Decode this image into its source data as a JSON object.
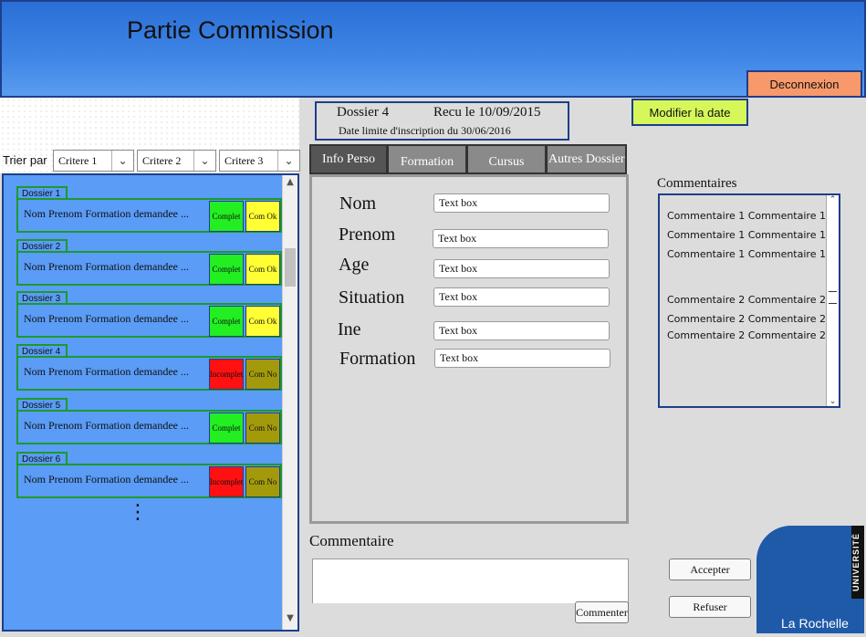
{
  "header": {
    "title": "Partie Commission",
    "logout_label": "Deconnexion"
  },
  "sort": {
    "label": "Trier par",
    "criteria": [
      "Critere 1",
      "Critere 2",
      "Critere 3"
    ]
  },
  "dossiers": [
    {
      "tag": "Dossier 1",
      "info": "Nom   Prenom   Formation demandee   ...",
      "status": "Complet",
      "status_color": "#22ee22",
      "com": "Com Ok",
      "com_color": "#ffff33"
    },
    {
      "tag": "Dossier 2",
      "info": "Nom   Prenom   Formation demandee   ...",
      "status": "Complet",
      "status_color": "#22ee22",
      "com": "Com Ok",
      "com_color": "#ffff33"
    },
    {
      "tag": "Dossier 3",
      "info": "Nom   Prenom   Formation demandee   ...",
      "status": "Complet",
      "status_color": "#22ee22",
      "com": "Com Ok",
      "com_color": "#ffff33"
    },
    {
      "tag": "Dossier 4",
      "info": "Nom   Prenom   Formation demandee   ...",
      "status": "Incomplet",
      "status_color": "#ff1111",
      "com": "Com No",
      "com_color": "#a39a0b"
    },
    {
      "tag": "Dossier 5",
      "info": "Nom   Prenom   Formation demandee   ...",
      "status": "Complet",
      "status_color": "#22ee22",
      "com": "Com No",
      "com_color": "#a39a0b"
    },
    {
      "tag": "Dossier 6",
      "info": "Nom   Prenom   Formation demandee   ...",
      "status": "Incomplet",
      "status_color": "#ff1111",
      "com": "Com No",
      "com_color": "#a39a0b"
    }
  ],
  "dossier_info": {
    "name": "Dossier 4",
    "received": "Recu le 10/09/2015",
    "deadline": "Date limite d'inscription du  30/06/2016",
    "modify_label": "Modifier la date"
  },
  "tabs": [
    "Info Perso",
    "Formation",
    "Cursus",
    "Autres Dossiers"
  ],
  "form": {
    "fields": [
      {
        "label": "Nom",
        "value": "Text box"
      },
      {
        "label": "Prenom",
        "value": "Text box"
      },
      {
        "label": "Age",
        "value": "Text box"
      },
      {
        "label": "Situation",
        "value": "Text box"
      },
      {
        "label": "Ine",
        "value": "Text box"
      },
      {
        "label": "Formation",
        "value": "Text box"
      }
    ]
  },
  "comment": {
    "label": "Commentaire",
    "submit_label": "Commenter"
  },
  "comments": {
    "title": "Commentaires",
    "lines": [
      "Commentaire 1 Commentaire 1",
      "Commentaire 1 Commentaire 1",
      "Commentaire 1 Commentaire 1",
      "Commentaire 2 Commentaire 2",
      "Commentaire 2 Commentaire 2",
      "Commentaire 2 Commentaire 2"
    ]
  },
  "actions": {
    "accept": "Accepter",
    "refuse": "Refuser"
  },
  "logo": {
    "vertical": "UNIVERSITÉ",
    "city": "La Rochelle"
  },
  "colors": {
    "header": "#3f86e6",
    "list_bg": "#5a9cf6",
    "border": "#1d3f8a",
    "green": "#1c9a2c"
  }
}
